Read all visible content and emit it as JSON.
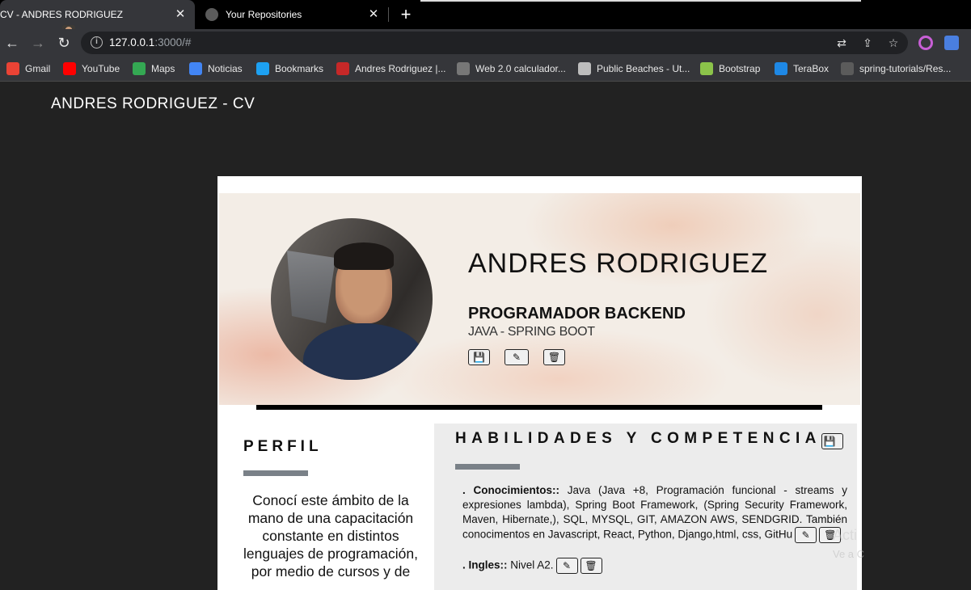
{
  "browser": {
    "tabs": [
      {
        "title": "CV - ANDRES RODRIGUEZ"
      },
      {
        "title": "Your Repositories"
      }
    ],
    "address": {
      "host": "127.0.0.1",
      "rest": ":3000/#"
    },
    "bookmarks": [
      {
        "label": "Gmail",
        "color": "#ea4335"
      },
      {
        "label": "YouTube",
        "color": "#ff0000"
      },
      {
        "label": "Maps",
        "color": "#34a853"
      },
      {
        "label": "Noticias",
        "color": "#4285f4"
      },
      {
        "label": "Bookmarks",
        "color": "#1da1f2"
      },
      {
        "label": "Andres Rodriguez |...",
        "color": "#c62828"
      },
      {
        "label": "Web 2.0 calculador...",
        "color": "#777777"
      },
      {
        "label": "Public Beaches - Ut...",
        "color": "#bdbdbd"
      },
      {
        "label": "Bootstrap",
        "color": "#8bc34a"
      },
      {
        "label": "TeraBox",
        "color": "#1e88e5"
      },
      {
        "label": "spring-tutorials/Res...",
        "color": "#5b5b5b"
      }
    ]
  },
  "page": {
    "site_title": "ANDRES RODRIGUEZ - CV",
    "header": {
      "name": "ANDRES RODRIGUEZ",
      "role": "PROGRAMADOR BACKEND",
      "stack": "JAVA - SPRING BOOT"
    },
    "perfil": {
      "title": "PERFIL",
      "text": "Conocí este ámbito de la mano de una capacitación constante en distintos lenguajes de programación, por medio de cursos y de"
    },
    "skills": {
      "title": "HABILIDADES Y COMPETENCIA",
      "items": [
        {
          "label": ". Conocimientos::",
          "value": " Java (Java +8, Programación funcional - streams y expresiones lambda), Spring Boot Framework, (Spring Security Framework, Maven, Hibernate,), SQL, MYSQL, GIT, AMAZON AWS, SENDGRID. También conocimentos en Javascript, React, Python, Django,html, css, GitHu"
        },
        {
          "label": ". Ingles::",
          "value": " Nivel A2."
        }
      ]
    },
    "watermark": {
      "line1": "Acti",
      "line2": "Ve a C"
    }
  }
}
